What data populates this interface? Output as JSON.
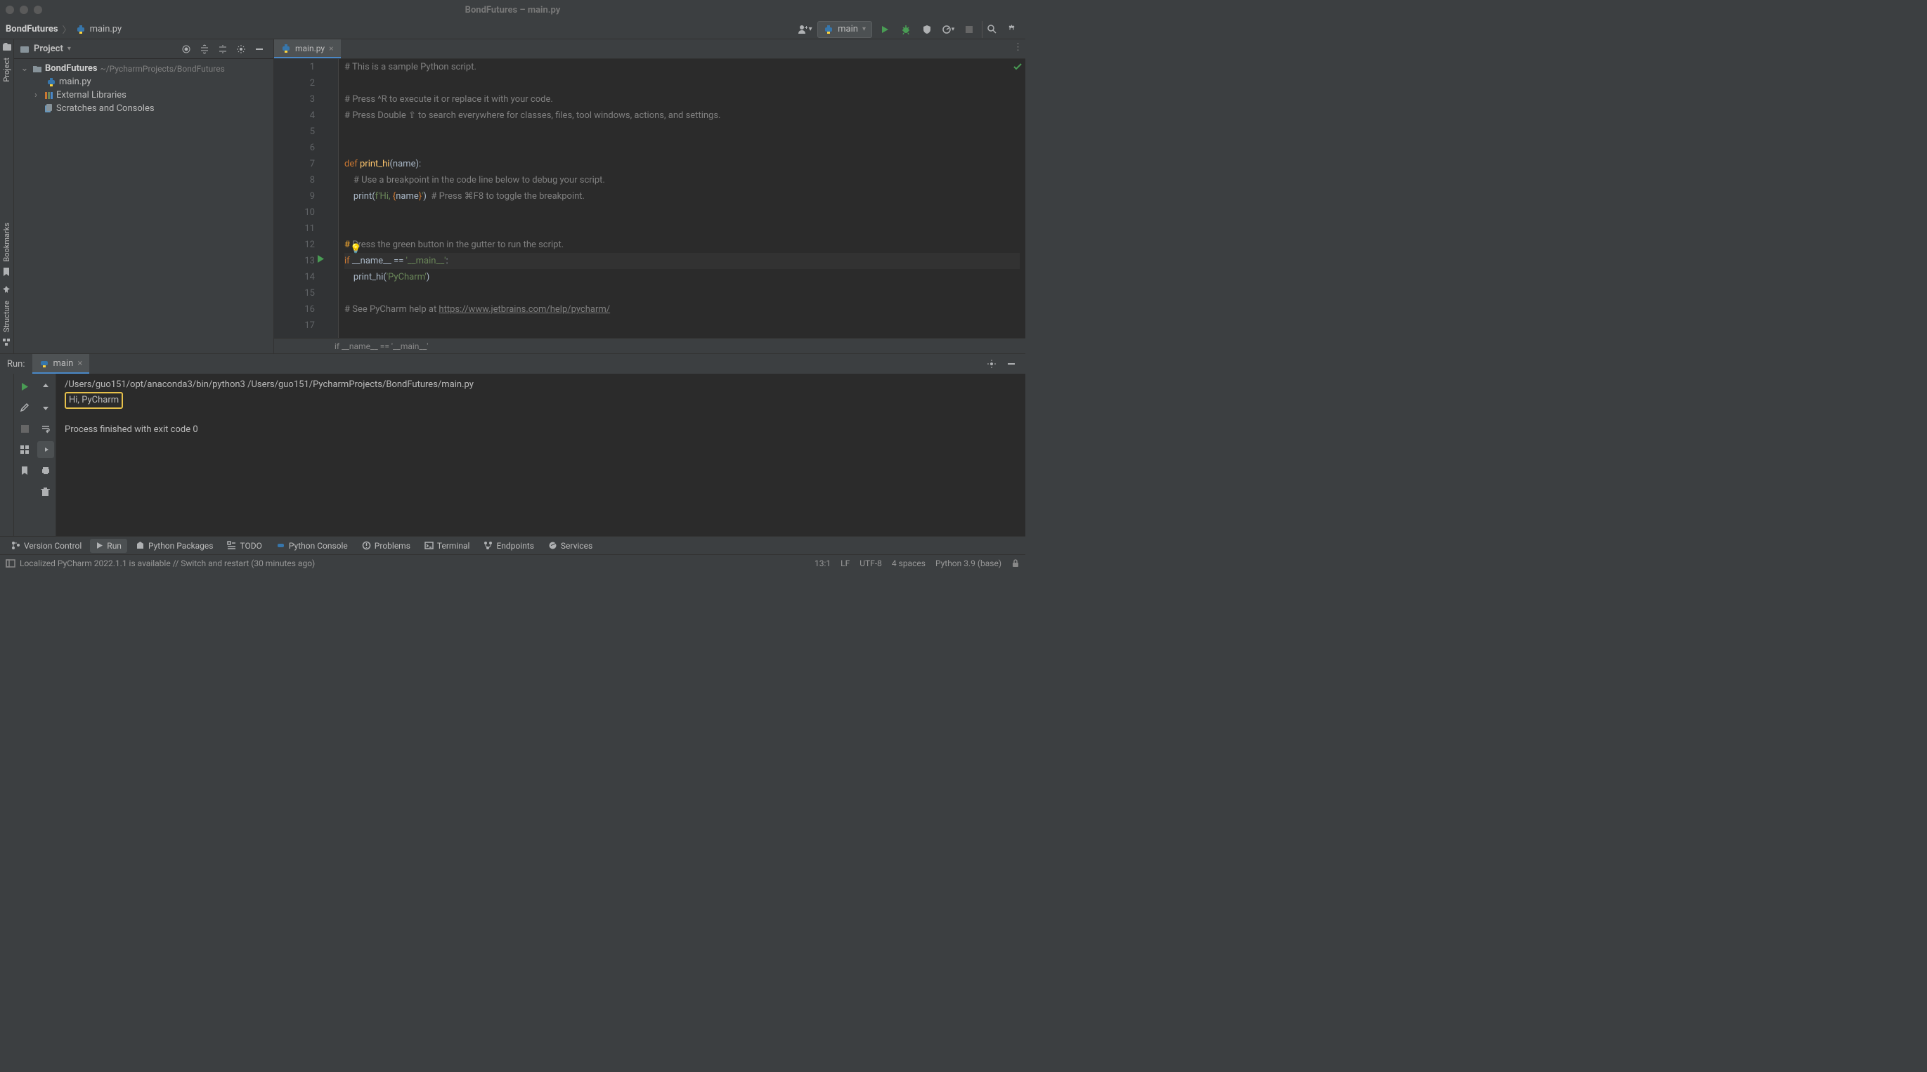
{
  "window": {
    "title": "BondFutures – main.py"
  },
  "breadcrumb": {
    "project": "BondFutures",
    "file": "main.py"
  },
  "run_config": {
    "label": "main"
  },
  "project_panel": {
    "title": "Project",
    "root": {
      "name": "BondFutures",
      "path": "~/PycharmProjects/BondFutures"
    },
    "items": [
      "main.py"
    ],
    "external": "External Libraries",
    "scratches": "Scratches and Consoles"
  },
  "editor_tab": {
    "label": "main.py"
  },
  "code": {
    "context": "if __name__ == '__main__'",
    "lines": [
      {
        "n": 1,
        "tokens": [
          {
            "t": "# This is a sample Python script.",
            "c": "c-comment"
          }
        ]
      },
      {
        "n": 2,
        "tokens": []
      },
      {
        "n": 3,
        "tokens": [
          {
            "t": "# Press ^R to execute it or replace it with your code.",
            "c": "c-comment"
          }
        ]
      },
      {
        "n": 4,
        "tokens": [
          {
            "t": "# Press Double ⇧ to search everywhere for classes, files, tool windows, actions, and settings.",
            "c": "c-comment"
          }
        ]
      },
      {
        "n": 5,
        "tokens": []
      },
      {
        "n": 6,
        "tokens": []
      },
      {
        "n": 7,
        "tokens": [
          {
            "t": "def ",
            "c": "c-keyword"
          },
          {
            "t": "print_hi",
            "c": "c-def"
          },
          {
            "t": "(name):",
            "c": ""
          }
        ]
      },
      {
        "n": 8,
        "tokens": [
          {
            "t": "    ",
            "c": ""
          },
          {
            "t": "# Use a breakpoint in the code line below to debug your script.",
            "c": "c-comment"
          }
        ]
      },
      {
        "n": 9,
        "tokens": [
          {
            "t": "    print(",
            "c": ""
          },
          {
            "t": "f'Hi, ",
            "c": "c-str"
          },
          {
            "t": "{",
            "c": "c-keyword"
          },
          {
            "t": "name",
            "c": ""
          },
          {
            "t": "}",
            "c": "c-keyword"
          },
          {
            "t": "'",
            "c": "c-str"
          },
          {
            "t": ")  ",
            "c": ""
          },
          {
            "t": "# Press ⌘F8 to toggle the breakpoint.",
            "c": "c-comment"
          }
        ]
      },
      {
        "n": 10,
        "tokens": []
      },
      {
        "n": 11,
        "tokens": []
      },
      {
        "n": 12,
        "bulb": true,
        "tokens": [
          {
            "t": "# Press the green button in the gutter to run the script.",
            "c": "c-comment"
          }
        ]
      },
      {
        "n": 13,
        "run": true,
        "hl": true,
        "tokens": [
          {
            "t": "if ",
            "c": "c-keyword"
          },
          {
            "t": "__name__ == ",
            "c": ""
          },
          {
            "t": "'__main__'",
            "c": "c-str"
          },
          {
            "t": ":",
            "c": ""
          }
        ]
      },
      {
        "n": 14,
        "tokens": [
          {
            "t": "    print_hi(",
            "c": ""
          },
          {
            "t": "'PyCharm'",
            "c": "c-str"
          },
          {
            "t": ")",
            "c": ""
          }
        ]
      },
      {
        "n": 15,
        "tokens": []
      },
      {
        "n": 16,
        "tokens": [
          {
            "t": "# See PyCharm help at ",
            "c": "c-comment"
          },
          {
            "t": "https://www.jetbrains.com/help/pycharm/",
            "c": "c-link"
          }
        ]
      },
      {
        "n": 17,
        "tokens": []
      }
    ]
  },
  "run_panel": {
    "label": "Run:",
    "tab": "main",
    "output": {
      "cmd": "/Users/guo151/opt/anaconda3/bin/python3 /Users/guo151/PycharmProjects/BondFutures/main.py",
      "result": "Hi, PyCharm",
      "exit": "Process finished with exit code 0"
    }
  },
  "left_rail": {
    "project": "Project",
    "bookmarks": "Bookmarks",
    "structure": "Structure"
  },
  "bottom_tabs": {
    "version_control": "Version Control",
    "run": "Run",
    "python_packages": "Python Packages",
    "todo": "TODO",
    "python_console": "Python Console",
    "problems": "Problems",
    "terminal": "Terminal",
    "endpoints": "Endpoints",
    "services": "Services"
  },
  "status": {
    "message": "Localized PyCharm 2022.1.1 is available // Switch and restart (30 minutes ago)",
    "position": "13:1",
    "lineend": "LF",
    "encoding": "UTF-8",
    "indent": "4 spaces",
    "interpreter": "Python 3.9 (base)"
  }
}
